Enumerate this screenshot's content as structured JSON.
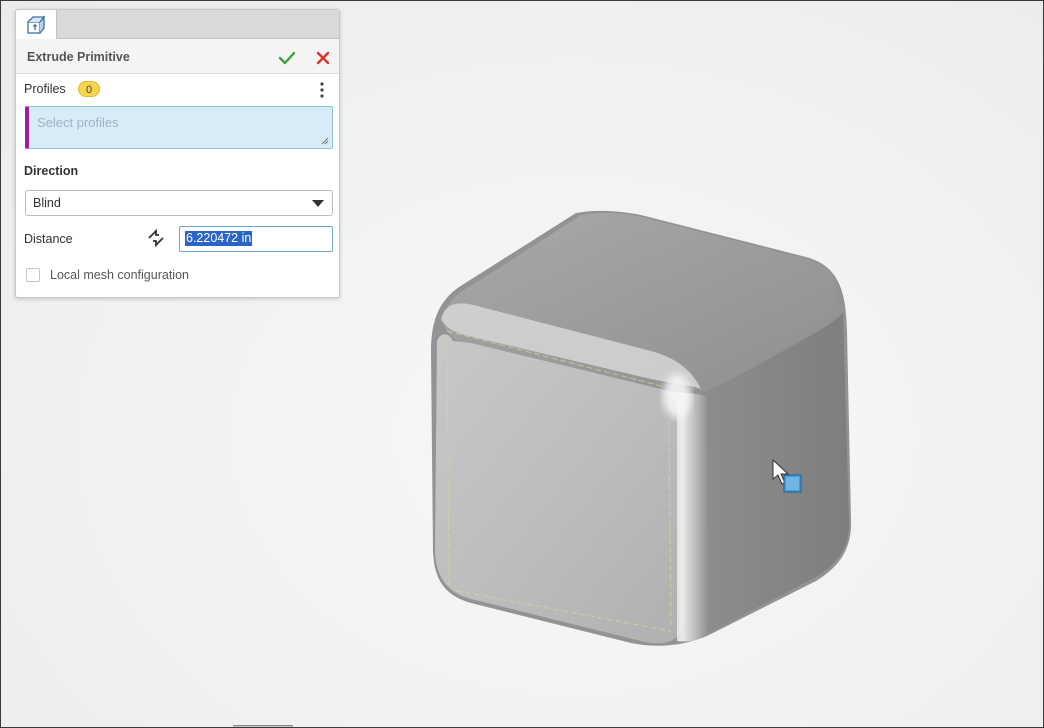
{
  "dialog": {
    "title": "Extrude Primitive",
    "tab_icon": "extrude-feature-icon",
    "accept_icon": "check-icon",
    "cancel_icon": "close-icon",
    "accent_color": "#9b1fa7",
    "accept_color": "#3aa23a",
    "cancel_color": "#e0302a"
  },
  "profiles": {
    "label": "Profiles",
    "count": "0",
    "placeholder": "Select profiles"
  },
  "direction": {
    "title": "Direction",
    "type_value": "Blind"
  },
  "distance": {
    "label": "Distance",
    "value": "6.220472 in"
  },
  "local_mesh": {
    "label": "Local mesh configuration",
    "checked": false
  },
  "viewport": {
    "model": "rounded-cube",
    "cursor_icon": "select-face-cursor-icon"
  }
}
